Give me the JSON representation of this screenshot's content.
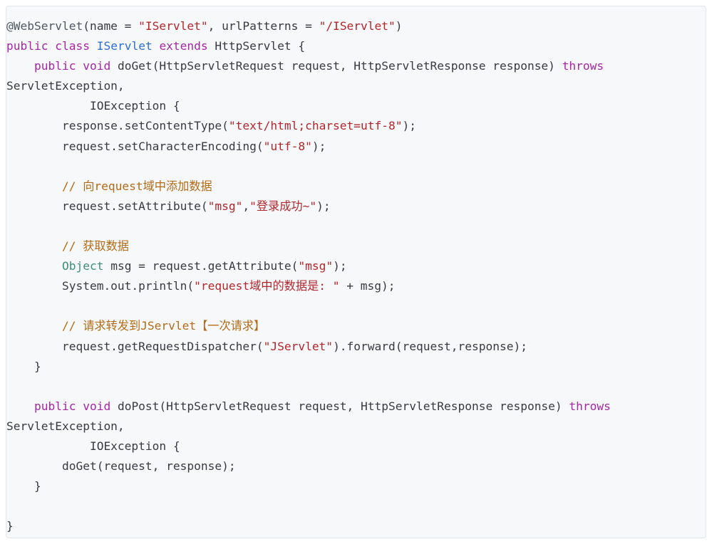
{
  "code": {
    "lines": [
      [
        {
          "t": "@WebServlet",
          "c": "ann"
        },
        {
          "t": "(name = ",
          "c": "pln"
        },
        {
          "t": "\"IServlet\"",
          "c": "str"
        },
        {
          "t": ", urlPatterns = ",
          "c": "pln"
        },
        {
          "t": "\"/IServlet\"",
          "c": "str"
        },
        {
          "t": ")",
          "c": "pln"
        }
      ],
      [
        {
          "t": "public",
          "c": "kw"
        },
        {
          "t": " ",
          "c": "pln"
        },
        {
          "t": "class",
          "c": "kw"
        },
        {
          "t": " ",
          "c": "pln"
        },
        {
          "t": "IServlet",
          "c": "cls"
        },
        {
          "t": " ",
          "c": "pln"
        },
        {
          "t": "extends",
          "c": "kw"
        },
        {
          "t": " HttpServlet {",
          "c": "pln"
        }
      ],
      [
        {
          "t": "    ",
          "c": "pln"
        },
        {
          "t": "public",
          "c": "kw"
        },
        {
          "t": " ",
          "c": "pln"
        },
        {
          "t": "void",
          "c": "kw"
        },
        {
          "t": " doGet(HttpServletRequest request, HttpServletResponse response) ",
          "c": "pln"
        },
        {
          "t": "throws",
          "c": "kw"
        }
      ],
      [
        {
          "t": "ServletException,",
          "c": "pln"
        }
      ],
      [
        {
          "t": "            IOException {",
          "c": "pln"
        }
      ],
      [
        {
          "t": "        response.setContentType(",
          "c": "pln"
        },
        {
          "t": "\"text/html;charset=utf-8\"",
          "c": "str"
        },
        {
          "t": ");",
          "c": "pln"
        }
      ],
      [
        {
          "t": "        request.setCharacterEncoding(",
          "c": "pln"
        },
        {
          "t": "\"utf-8\"",
          "c": "str"
        },
        {
          "t": ");",
          "c": "pln"
        }
      ],
      [
        {
          "t": "",
          "c": "pln"
        }
      ],
      [
        {
          "t": "        ",
          "c": "pln"
        },
        {
          "t": "// 向request域中添加数据",
          "c": "cmt"
        }
      ],
      [
        {
          "t": "        request.setAttribute(",
          "c": "pln"
        },
        {
          "t": "\"msg\"",
          "c": "str"
        },
        {
          "t": ",",
          "c": "pln"
        },
        {
          "t": "\"登录成功~\"",
          "c": "str"
        },
        {
          "t": ");",
          "c": "pln"
        }
      ],
      [
        {
          "t": "",
          "c": "pln"
        }
      ],
      [
        {
          "t": "        ",
          "c": "pln"
        },
        {
          "t": "// 获取数据",
          "c": "cmt"
        }
      ],
      [
        {
          "t": "        ",
          "c": "pln"
        },
        {
          "t": "Object",
          "c": "typ"
        },
        {
          "t": " msg = request.getAttribute(",
          "c": "pln"
        },
        {
          "t": "\"msg\"",
          "c": "str"
        },
        {
          "t": ");",
          "c": "pln"
        }
      ],
      [
        {
          "t": "        System.out.println(",
          "c": "pln"
        },
        {
          "t": "\"request域中的数据是: \"",
          "c": "str"
        },
        {
          "t": " + msg);",
          "c": "pln"
        }
      ],
      [
        {
          "t": "",
          "c": "pln"
        }
      ],
      [
        {
          "t": "        ",
          "c": "pln"
        },
        {
          "t": "// 请求转发到JServlet【一次请求】",
          "c": "cmt"
        }
      ],
      [
        {
          "t": "        request.getRequestDispatcher(",
          "c": "pln"
        },
        {
          "t": "\"JServlet\"",
          "c": "str"
        },
        {
          "t": ").forward(request,response);",
          "c": "pln"
        }
      ],
      [
        {
          "t": "    }",
          "c": "pln"
        }
      ],
      [
        {
          "t": "",
          "c": "pln"
        }
      ],
      [
        {
          "t": "    ",
          "c": "pln"
        },
        {
          "t": "public",
          "c": "kw"
        },
        {
          "t": " ",
          "c": "pln"
        },
        {
          "t": "void",
          "c": "kw"
        },
        {
          "t": " doPost(HttpServletRequest request, HttpServletResponse response) ",
          "c": "pln"
        },
        {
          "t": "throws",
          "c": "kw"
        }
      ],
      [
        {
          "t": "ServletException,",
          "c": "pln"
        }
      ],
      [
        {
          "t": "            IOException {",
          "c": "pln"
        }
      ],
      [
        {
          "t": "        doGet(request, response);",
          "c": "pln"
        }
      ],
      [
        {
          "t": "    }",
          "c": "pln"
        }
      ],
      [
        {
          "t": "",
          "c": "pln"
        }
      ],
      [
        {
          "t": "}",
          "c": "pln"
        }
      ]
    ]
  },
  "colors": {
    "background": "#f6f8fa",
    "keyword": "#a626a4",
    "class_name": "#2b6fd6",
    "string": "#b3262b",
    "comment": "#b36b16",
    "type": "#3c8f72",
    "plain": "#383a42"
  }
}
